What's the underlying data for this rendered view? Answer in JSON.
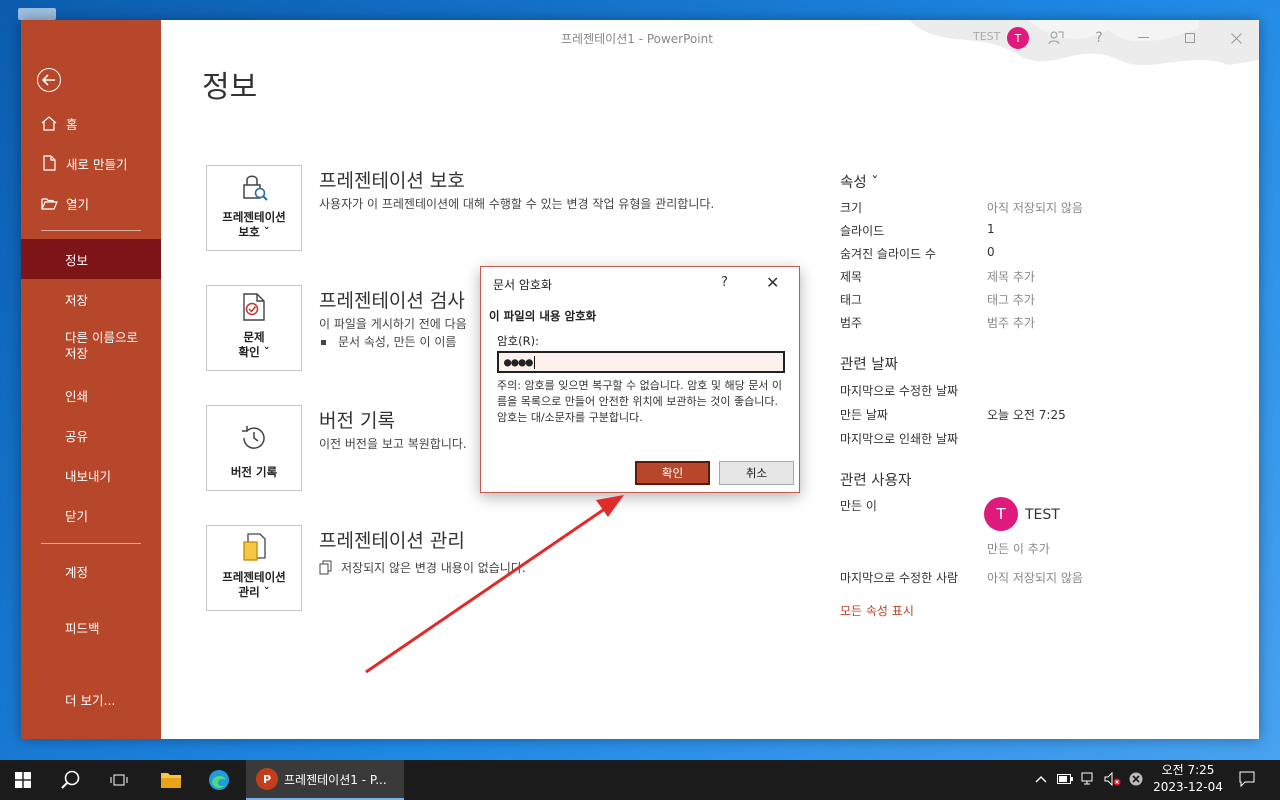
{
  "window": {
    "title": "프레젠테이션1  -  PowerPoint",
    "user": "TEST",
    "user_initial": "T",
    "heading": "정보"
  },
  "nav": {
    "home": "홈",
    "new": "새로 만들기",
    "open": "열기",
    "info": "정보",
    "save": "저장",
    "save_as": "다른 이름으로\n저장",
    "print": "인쇄",
    "share": "공유",
    "export": "내보내기",
    "close": "닫기",
    "account": "계정",
    "feedback": "피드백",
    "more": "더 보기..."
  },
  "sections": {
    "protect": {
      "tile": "프레젠테이션\n보호 ˇ",
      "title": "프레젠테이션 보호",
      "desc": "사용자가 이 프레젠테이션에 대해 수행할 수 있는 변경 작업 유형을 관리합니다."
    },
    "inspect": {
      "tile": "문제\n확인 ˇ",
      "title": "프레젠테이션 검사",
      "desc": "이 파일을 게시하기 전에 다음",
      "bullet": "문서 속성, 만든 이 이름"
    },
    "version": {
      "tile": "버전 기록",
      "title": "버전 기록",
      "desc": "이전 버전을 보고 복원합니다."
    },
    "manage": {
      "tile": "프레젠테이션\n관리 ˇ",
      "title": "프레젠테이션 관리",
      "desc": "저장되지 않은 변경 내용이 없습니다."
    }
  },
  "properties": {
    "heading": "속성 ˇ",
    "size_label": "크기",
    "size_value": "아직 저장되지 않음",
    "slides_label": "슬라이드",
    "slides_value": "1",
    "hidden_label": "숨겨진 슬라이드 수",
    "hidden_value": "0",
    "title_label": "제목",
    "title_value": "제목 추가",
    "tags_label": "태그",
    "tags_value": "태그 추가",
    "category_label": "범주",
    "category_value": "범주 추가",
    "dates_heading": "관련 날짜",
    "modified_label": "마지막으로 수정한 날짜",
    "created_label": "만든 날짜",
    "created_value": "오늘 오전 7:25",
    "printed_label": "마지막으로 인쇄한 날짜",
    "people_heading": "관련 사용자",
    "author_label": "만든 이",
    "author_name": "TEST",
    "author_initial": "T",
    "add_author": "만든 이 추가",
    "last_modified_by_label": "마지막으로 수정한 사람",
    "last_modified_by_value": "아직 저장되지 않음",
    "show_all": "모든 속성 표시"
  },
  "dialog": {
    "title": "문서 암호화",
    "help": "?",
    "close": "✕",
    "heading": "이 파일의 내용 암호화",
    "password_label": "암호(R):",
    "password_value": "●●●●",
    "note": "주의: 암호를 잊으면 복구할 수 없습니다. 암호 및 해당 문서 이름을 목록으로 만들어 안전한 위치에 보관하는 것이 좋습니다.\n암호는 대/소문자를 구분합니다.",
    "ok": "확인",
    "cancel": "취소"
  },
  "taskbar": {
    "app_label": "프레젠테이션1 - P...",
    "app_badge": "P",
    "time": "오전 7:25",
    "date": "2023-12-04"
  },
  "colors": {
    "accent": "#b7472a",
    "nav_active": "#7c1418",
    "avatar": "#e0197d"
  }
}
